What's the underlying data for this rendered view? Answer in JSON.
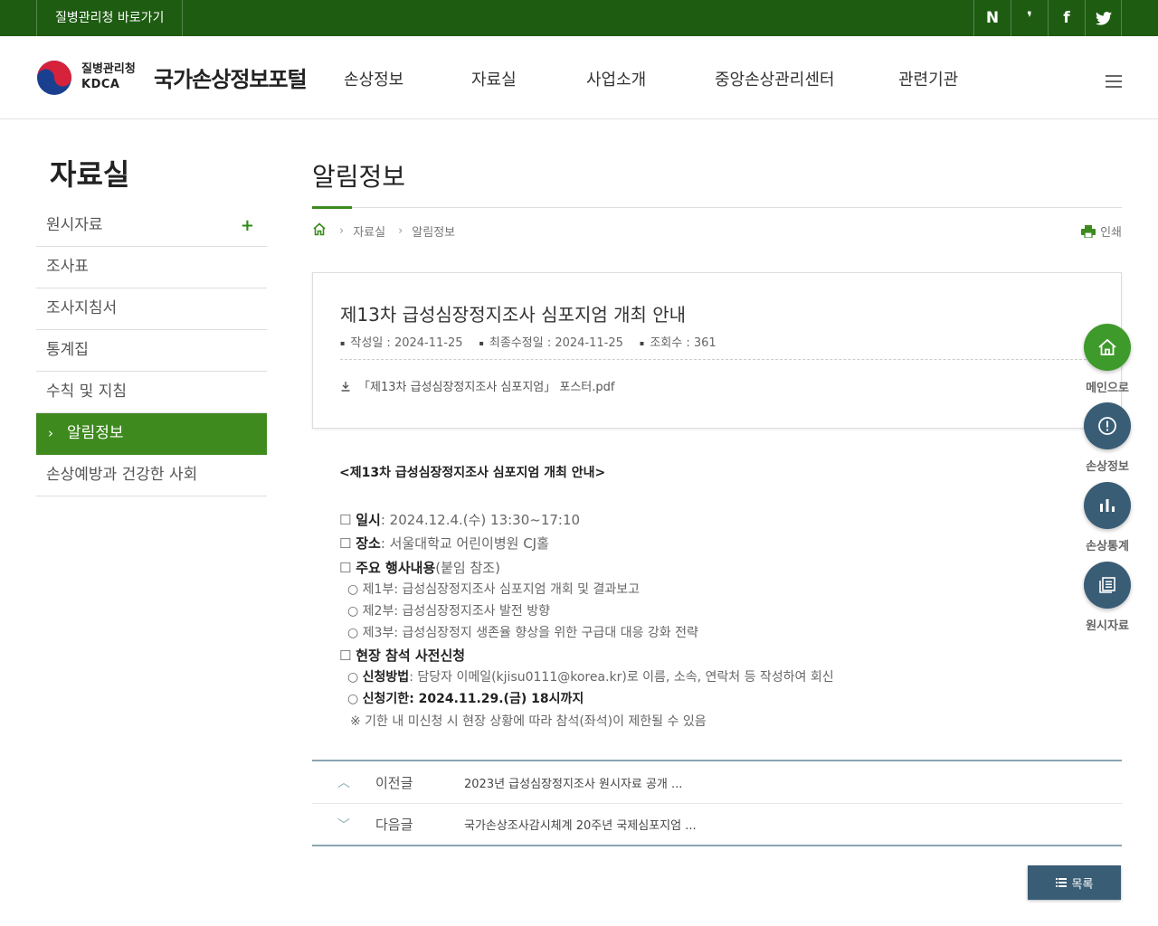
{
  "topbar": {
    "kdca_link": "질병관리청 바로가기",
    "sns": [
      "N",
      "❜",
      "f",
      "t"
    ]
  },
  "header": {
    "org_name": "질병관리청",
    "org_en": "KDCA",
    "portal_title": "국가손상정보포털",
    "nav": [
      "손상정보",
      "자료실",
      "사업소개",
      "중앙손상관리센터",
      "관련기관"
    ]
  },
  "sidebar": {
    "title": "자료실",
    "items": [
      {
        "label": "원시자료",
        "has_plus": true
      },
      {
        "label": "조사표"
      },
      {
        "label": "조사지침서"
      },
      {
        "label": "통계집"
      },
      {
        "label": "수칙 및 지침"
      },
      {
        "label": "알림정보",
        "active": true
      },
      {
        "label": "손상예방과 건강한 사회"
      }
    ]
  },
  "content": {
    "page_title": "알림정보",
    "breadcrumb": [
      "자료실",
      "알림정보"
    ],
    "print_label": "인쇄",
    "post": {
      "title": "제13차 급성심장정지조사 심포지엄 개최 안내",
      "created": "작성일 : 2024-11-25",
      "modified": "최종수정일 : 2024-11-25",
      "views": "조회수 : 361",
      "attachment": "「제13차 급성심장정지조사 심포지엄」 포스터.pdf"
    },
    "body": {
      "heading": "<제13차 급성심장정지조사 심포지엄 개최 안내>",
      "date_label": "일시",
      "date_value": ": 2024.12.4.(수) 13:30~17:10",
      "place_label": "장소",
      "place_value": ": 서울대학교 어린이병원 CJ홀",
      "program_label": "주요 행사내용",
      "program_note": "(붙임 참조)",
      "part1": "○ 제1부: 급성심장정지조사 심포지엄 개회 및 결과보고",
      "part2": "○ 제2부: 급성심장정지조사 발전 방향",
      "part3": "○ 제3부: 급성심장정지 생존율 향상을 위한 구급대 대응 강화 전략",
      "register_label": "현장 참석 사전신청",
      "method_label": "신청방법",
      "method_value": ": 담당자 이메일(kjisu0111@korea.kr)로 이름, 소속, 연락처 등 작성하여 회신",
      "deadline_label": "신청기한",
      "deadline_value": ": 2024.11.29.(금) 18시까지",
      "note": "※ 기한 내 미신청 시 현장 상황에 따라 참석(좌석)이 제한될 수 있음",
      "box_symbol": "☐",
      "circle_symbol": "○"
    },
    "prev": {
      "label": "이전글",
      "title": "2023년 급성심장정지조사 원시자료 공개 ..."
    },
    "next": {
      "label": "다음글",
      "title": "국가손상조사감시체계 20주년 국제심포지엄 ..."
    },
    "list_button": "목록"
  },
  "quick_menu": [
    {
      "label": "메인으로",
      "icon": "home-icon",
      "color": "#3e9a2a"
    },
    {
      "label": "손상정보",
      "icon": "alert-icon",
      "color": "#3a5d76"
    },
    {
      "label": "손상통계",
      "icon": "bar-chart-icon",
      "color": "#3a5d76"
    },
    {
      "label": "원시자료",
      "icon": "document-icon",
      "color": "#3a5d76"
    }
  ],
  "colors": {
    "brand_green": "#1e5c12",
    "accent_green": "#3e8a1e",
    "navy": "#3a5d76"
  }
}
